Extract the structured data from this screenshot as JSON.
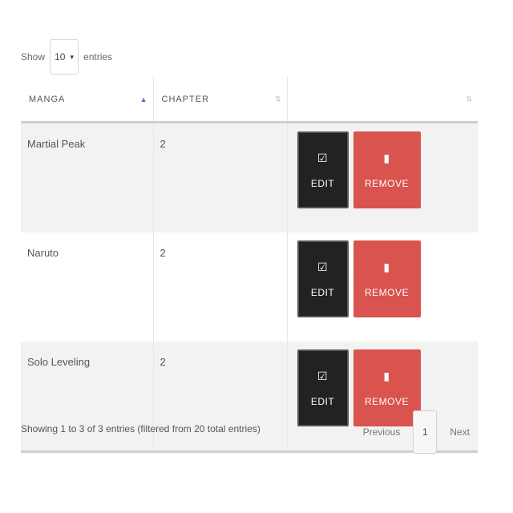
{
  "length_menu": {
    "prefix": "Show",
    "selected": "10",
    "suffix": "entries"
  },
  "table": {
    "columns": [
      {
        "label": "MANGA",
        "sort": "ascending"
      },
      {
        "label": "CHAPTER",
        "sort": "none"
      },
      {
        "label": "",
        "sort": "none"
      }
    ],
    "rows": [
      {
        "manga": "Martial Peak",
        "chapter": "2",
        "edit_label": "EDIT",
        "remove_label": "REMOVE"
      },
      {
        "manga": "Naruto",
        "chapter": "2",
        "edit_label": "EDIT",
        "remove_label": "REMOVE"
      },
      {
        "manga": "Solo Leveling",
        "chapter": "2",
        "edit_label": "EDIT",
        "remove_label": "REMOVE"
      }
    ]
  },
  "icons": {
    "edit": "☑",
    "remove": "▮",
    "sort_asc": "▲",
    "sort_both": "⇅",
    "select_chevron": "▾"
  },
  "info_text": "Showing 1 to 3 of 3 entries (filtered from 20 total entries)",
  "pagination": {
    "previous": "Previous",
    "current": "1",
    "next": "Next"
  },
  "colors": {
    "edit_bg": "#222222",
    "remove_bg": "#d9534f",
    "row_stripe": "#f2f2f2",
    "sort_active": "#4a72c9"
  }
}
